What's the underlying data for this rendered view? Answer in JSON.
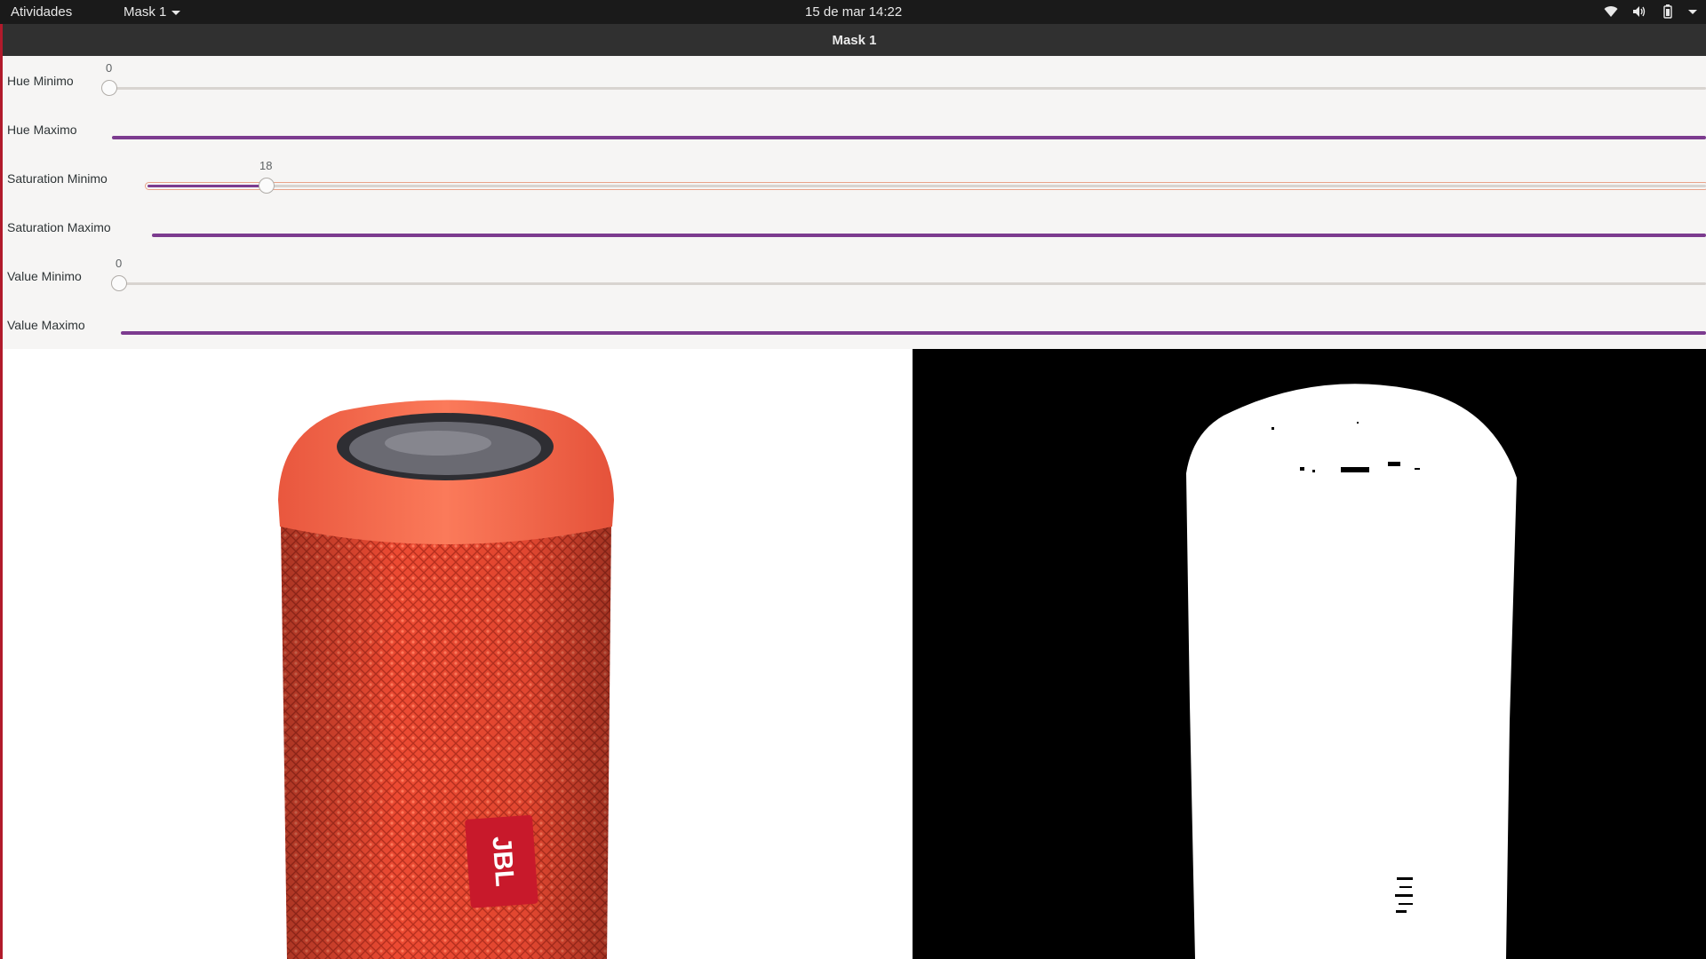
{
  "topbar": {
    "activities": "Atividades",
    "app_menu": "Mask 1",
    "clock": "15 de mar  14:22",
    "tray_icons": [
      "wifi-icon",
      "volume-icon",
      "battery-icon",
      "system-menu-caret-icon"
    ]
  },
  "window": {
    "title": "Mask 1",
    "sliders": [
      {
        "label": "Hue Minimo",
        "value": "0",
        "fraction": 0.0
      },
      {
        "label": "Hue Maximo",
        "value": "",
        "fraction": 1.0
      },
      {
        "label": "Saturation Minimo",
        "value": "18",
        "fraction": 0.074
      },
      {
        "label": "Saturation Maximo",
        "value": "",
        "fraction": 1.0
      },
      {
        "label": "Value Minimo",
        "value": "0",
        "fraction": 0.0
      },
      {
        "label": "Value Maximo",
        "value": "",
        "fraction": 1.0
      }
    ],
    "original_image": {
      "brand_text": "JBL",
      "subject": "orange cylindrical speaker"
    },
    "mask_image": {
      "subject": "binary mask of speaker"
    }
  },
  "colors": {
    "accent": "#7c3b8f",
    "window_border": "#b11a2b",
    "speaker": "#f0533a",
    "topbar": "#1a1a1a",
    "titlebar": "#303030"
  }
}
